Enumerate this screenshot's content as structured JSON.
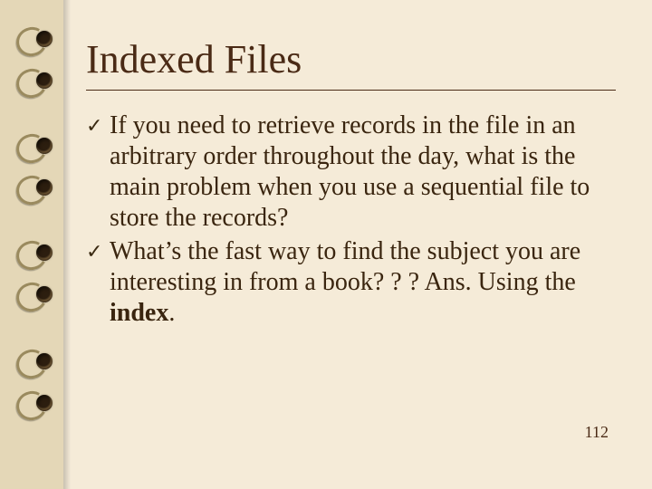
{
  "slide": {
    "title": "Indexed Files",
    "bullets": [
      {
        "text": "If you need to retrieve records in the file in an arbitrary order throughout the day, what is the main problem when you use a sequential file to store the records?"
      },
      {
        "text_pre": "What’s the fast way to find the subject you are interesting in from a book? ? ? Ans. Using the ",
        "text_bold": "index",
        "text_post": "."
      }
    ],
    "page_number": "112"
  }
}
